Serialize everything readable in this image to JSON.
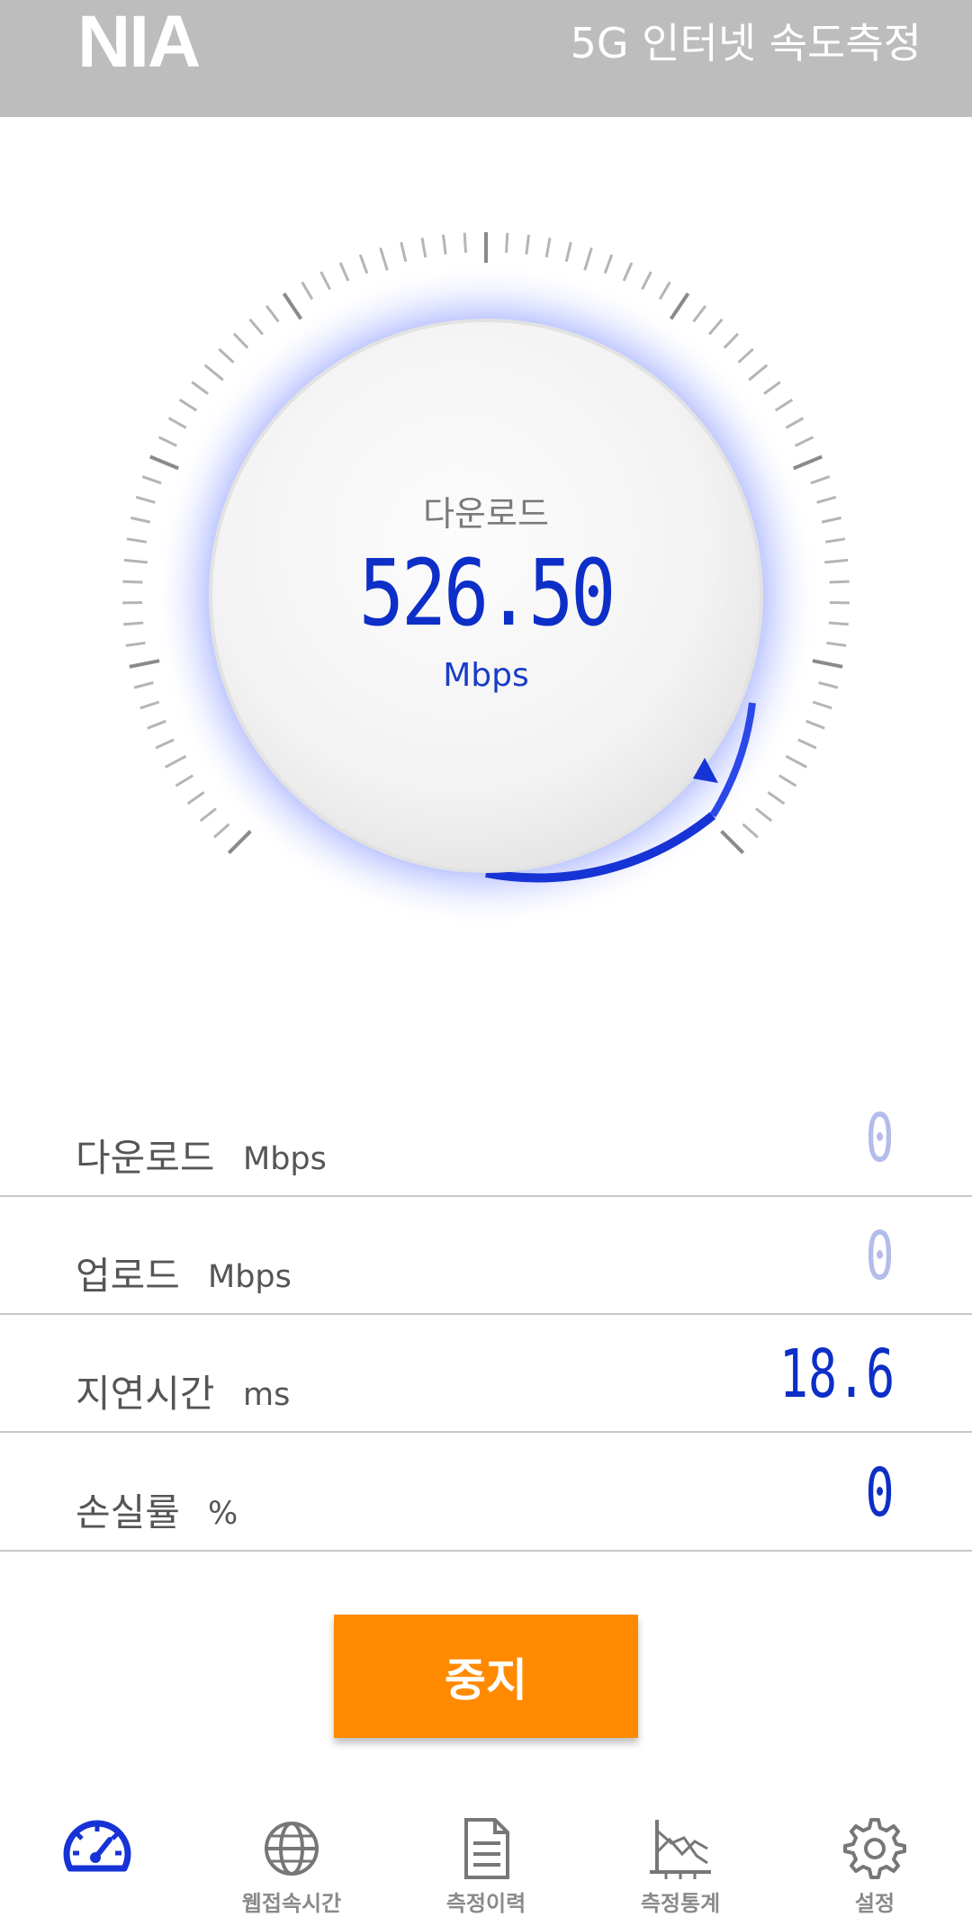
{
  "header": {
    "logo": "NIA",
    "title": "5G 인터넷 속도측정"
  },
  "gauge": {
    "label": "다운로드",
    "value": "526.50",
    "unit": "Mbps",
    "accent_color": "#0d2fc7"
  },
  "stats": [
    {
      "label": "다운로드",
      "unit": "Mbps",
      "value": "0",
      "state": "pending"
    },
    {
      "label": "업로드",
      "unit": "Mbps",
      "value": "0",
      "state": "pending"
    },
    {
      "label": "지연시간",
      "unit": "ms",
      "value": "18.6",
      "state": "done"
    },
    {
      "label": "손실률",
      "unit": "%",
      "value": "0",
      "state": "done"
    }
  ],
  "stop_button": {
    "label": "중지",
    "color": "#ff8a00"
  },
  "nav": {
    "items": [
      {
        "label": "",
        "icon": "speedometer-icon",
        "active": true
      },
      {
        "label": "웹접속시간",
        "icon": "globe-icon"
      },
      {
        "label": "측정이력",
        "icon": "document-icon"
      },
      {
        "label": "측정통계",
        "icon": "chart-icon"
      },
      {
        "label": "설정",
        "icon": "gear-icon"
      }
    ]
  }
}
